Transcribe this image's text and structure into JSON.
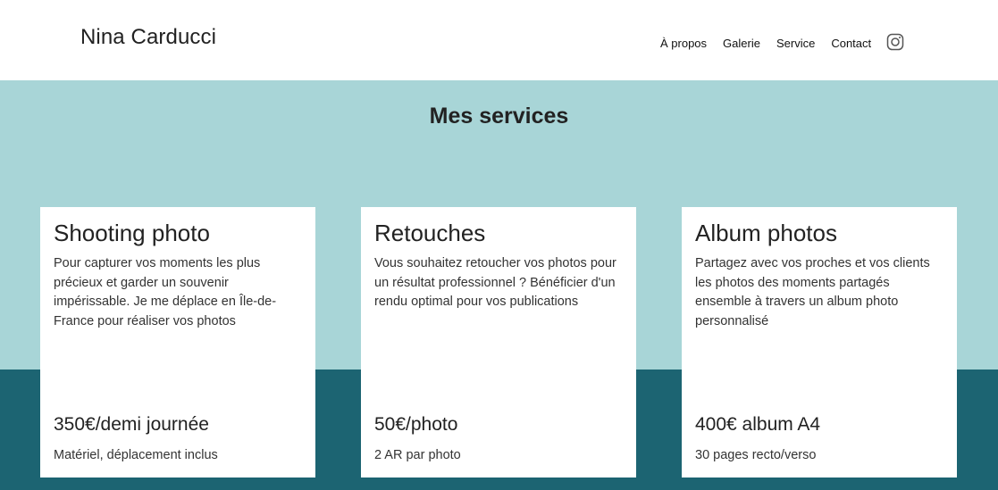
{
  "header": {
    "brand": "Nina Carducci",
    "nav": [
      "À propos",
      "Galerie",
      "Service",
      "Contact"
    ],
    "instagram_icon": "instagram-icon"
  },
  "services": {
    "title": "Mes services",
    "colors": {
      "light_bg": "#a8d5d7",
      "dark_bg": "#1c6472",
      "card_bg": "#ffffff"
    },
    "cards": [
      {
        "title": "Shooting photo",
        "description": "Pour capturer vos moments les plus précieux et garder un souvenir impérissable. Je me déplace en Île-de-France pour réaliser vos photos",
        "price": "350€/demi journée",
        "note": "Matériel, déplacement inclus"
      },
      {
        "title": "Retouches",
        "description": "Vous souhaitez retoucher vos photos pour un résultat professionnel ? Bénéficier d'un rendu optimal pour vos publications",
        "price": "50€/photo",
        "note": "2 AR par photo"
      },
      {
        "title": "Album photos",
        "description": "Partagez avec vos proches et vos clients les photos des moments partagés ensemble à travers un album photo personnalisé",
        "price": "400€ album A4",
        "note": "30 pages recto/verso"
      }
    ]
  }
}
